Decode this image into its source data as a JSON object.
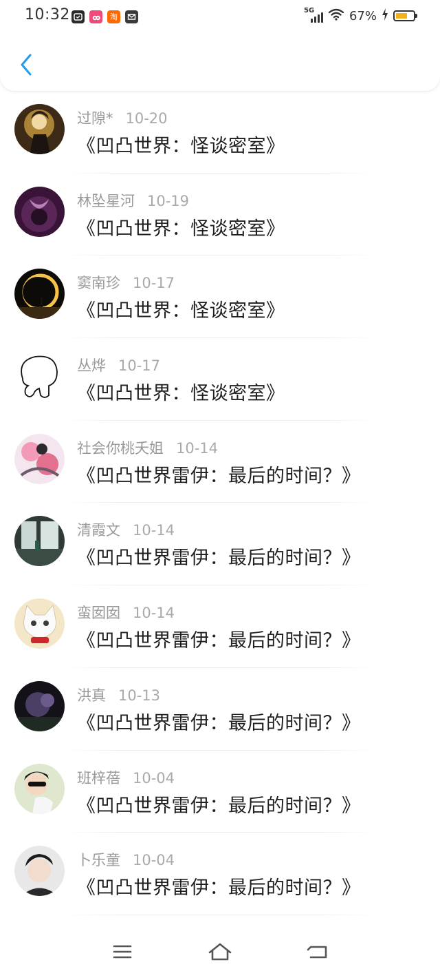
{
  "status_bar": {
    "time": "10:32",
    "app_icons": [
      "clock-app-icon",
      "weibo-app-icon",
      "taobao-app-icon",
      "message-app-icon"
    ],
    "taobao_glyph": "淘",
    "network": "5G",
    "battery_percent": "67%",
    "battery_level": 0.67,
    "charging": true
  },
  "nav": {
    "back_icon": "chevron-left-icon",
    "accent_color": "#1e9bea"
  },
  "items": [
    {
      "user": "过隙*",
      "date": "10-20",
      "title": "《凹凸世界：怪谈密室》"
    },
    {
      "user": "林坠星河",
      "date": "10-19",
      "title": "《凹凸世界：怪谈密室》"
    },
    {
      "user": "窦南珍",
      "date": "10-17",
      "title": "《凹凸世界：怪谈密室》"
    },
    {
      "user": "丛烨",
      "date": "10-17",
      "title": "《凹凸世界：怪谈密室》"
    },
    {
      "user": "社会你桃夭姐",
      "date": "10-14",
      "title": "《凹凸世界雷伊：最后的时间？》"
    },
    {
      "user": "清霞文",
      "date": "10-14",
      "title": "《凹凸世界雷伊：最后的时间？》"
    },
    {
      "user": "蛮囡囡",
      "date": "10-14",
      "title": "《凹凸世界雷伊：最后的时间？》"
    },
    {
      "user": "洪真",
      "date": "10-13",
      "title": "《凹凸世界雷伊：最后的时间？》"
    },
    {
      "user": "班梓蓓",
      "date": "10-04",
      "title": "《凹凸世界雷伊：最后的时间？》"
    },
    {
      "user": "卜乐童",
      "date": "10-04",
      "title": "《凹凸世界雷伊：最后的时间？》"
    }
  ],
  "bottom_nav": {
    "menu_icon": "menu-icon",
    "home_icon": "home-icon",
    "back_icon": "back-arrow-icon"
  }
}
